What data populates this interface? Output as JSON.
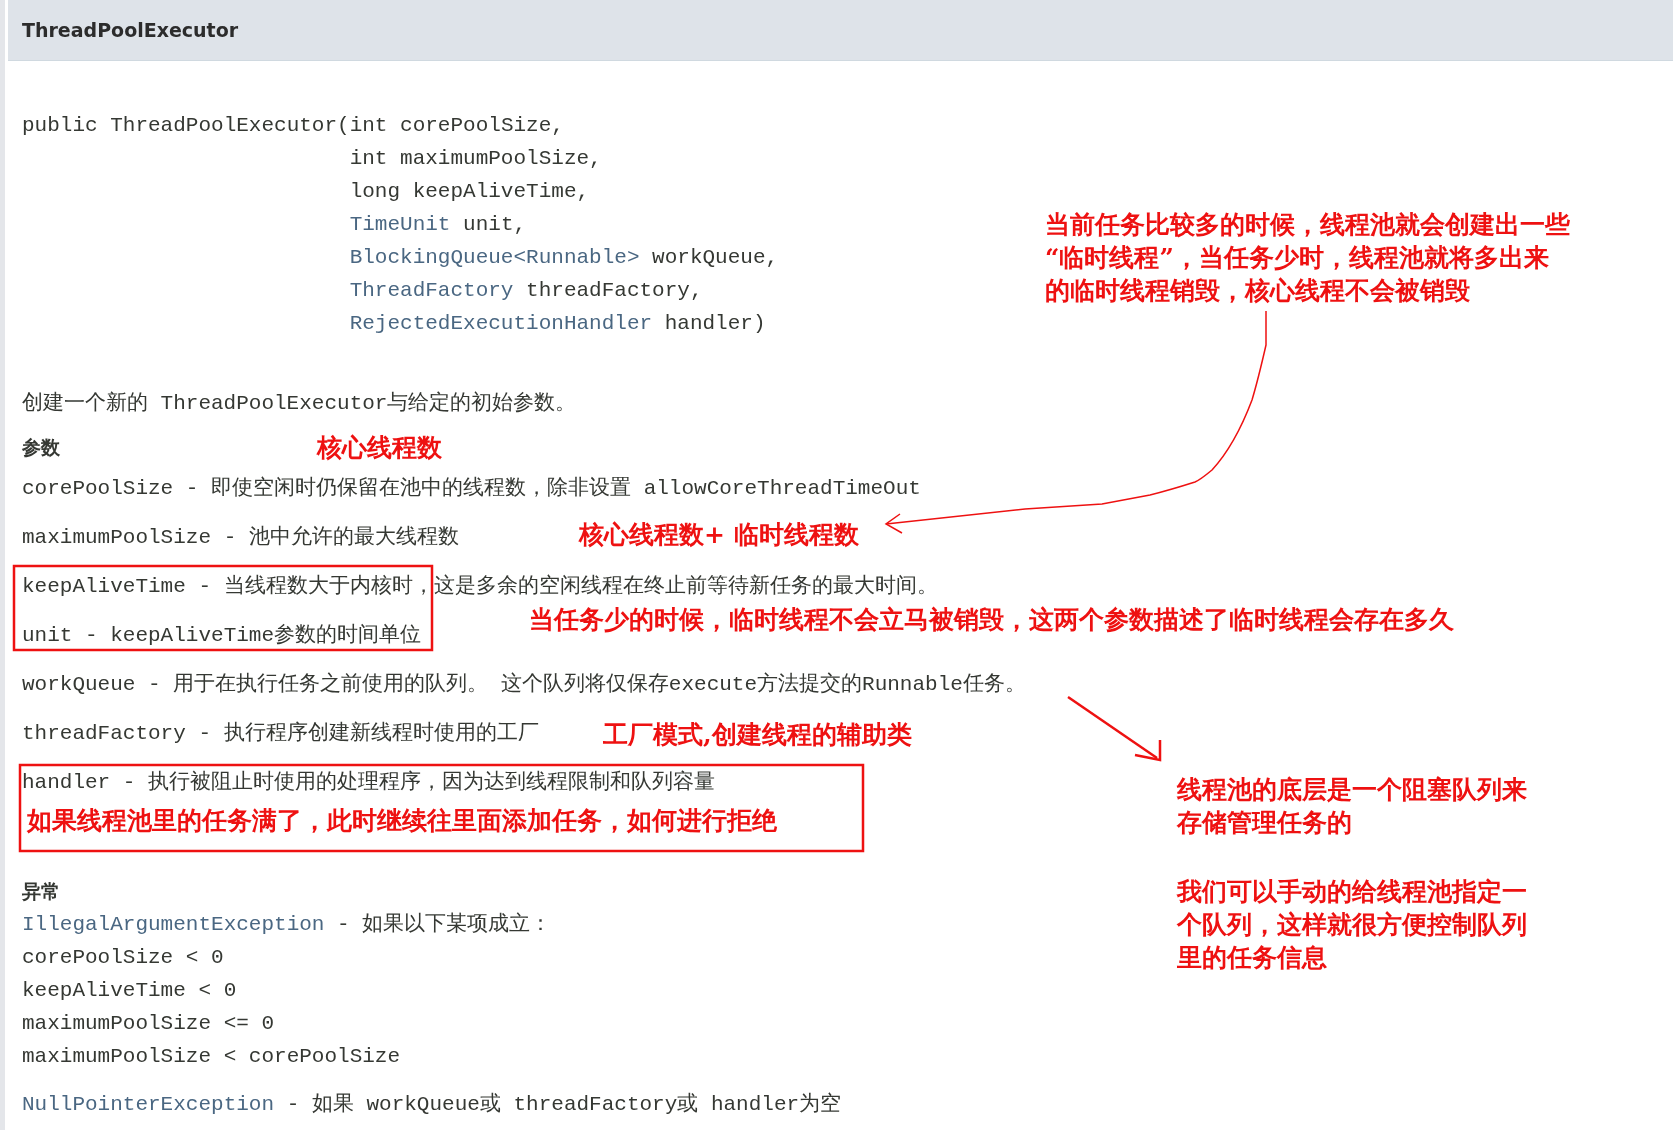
{
  "header": {
    "title": "ThreadPoolExecutor"
  },
  "signature": [
    {
      "text": "public ThreadPoolExecutor(int corePoolSize,"
    },
    {
      "text": "int maximumPoolSize,"
    },
    {
      "text": "long keepAliveTime,"
    },
    {
      "type": "TimeUnit",
      "text": " unit,"
    },
    {
      "type": "BlockingQueue<Runnable>",
      "text": " workQueue,"
    },
    {
      "type": "ThreadFactory",
      "text": " threadFactory,"
    },
    {
      "type": "RejectedExecutionHandler",
      "text": " handler)"
    }
  ],
  "description": "创建一个新的 ThreadPoolExecutor与给定的初始参数。",
  "params_heading": "参数",
  "params": [
    "corePoolSize - 即使空闲时仍保留在池中的线程数，除非设置 allowCoreThreadTimeOut",
    "maximumPoolSize - 池中允许的最大线程数",
    "keepAliveTime - 当线程数大于内核时，这是多余的空闲线程在终止前等待新任务的最大时间。",
    "unit - keepAliveTime参数的时间单位",
    "workQueue - 用于在执行任务之前使用的队列。 这个队列将仅保存execute方法提交的Runnable任务。",
    "threadFactory - 执行程序创建新线程时使用的工厂",
    "handler - 执行被阻止时使用的处理程序，因为达到线程限制和队列容量"
  ],
  "exceptions_heading": "异常",
  "exceptions": [
    {
      "name": "IllegalArgumentException",
      "text": " - 如果以下某项成立：",
      "conditions": [
        "corePoolSize < 0",
        "keepAliveTime < 0",
        "maximumPoolSize <= 0",
        "maximumPoolSize < corePoolSize"
      ]
    },
    {
      "name": "NullPointerException",
      "text": " - 如果 workQueue或 threadFactory或 handler为空"
    }
  ],
  "annotations": [
    {
      "kind": "core",
      "lines": [
        "核心线程数"
      ]
    },
    {
      "kind": "max",
      "lines": [
        "核心线程数+ 临时线程数"
      ]
    },
    {
      "kind": "temp",
      "lines": [
        "当前任务比较多的时候，线程池就会创建出一些",
        "“临时线程”，当任务少时，线程池就将多出来",
        "的临时线程销毁，核心线程不会被销毁"
      ]
    },
    {
      "kind": "alive",
      "lines": [
        "当任务少的时候，临时线程不会立马被销毁，这两个参数描述了临时线程会存在多久"
      ]
    },
    {
      "kind": "factory",
      "lines": [
        "工厂模式,创建线程的辅助类"
      ]
    },
    {
      "kind": "reject",
      "lines": [
        "如果线程池里的任务满了，此时继续往里面添加任务，如何进行拒绝"
      ]
    },
    {
      "kind": "queue",
      "lines": [
        "线程池的底层是一个阻塞队列来",
        "存储管理任务的"
      ]
    },
    {
      "kind": "custom",
      "lines": [
        "我们可以手动的给线程池指定一",
        "个队列，这样就很方便控制队列",
        "里的任务信息"
      ]
    }
  ]
}
